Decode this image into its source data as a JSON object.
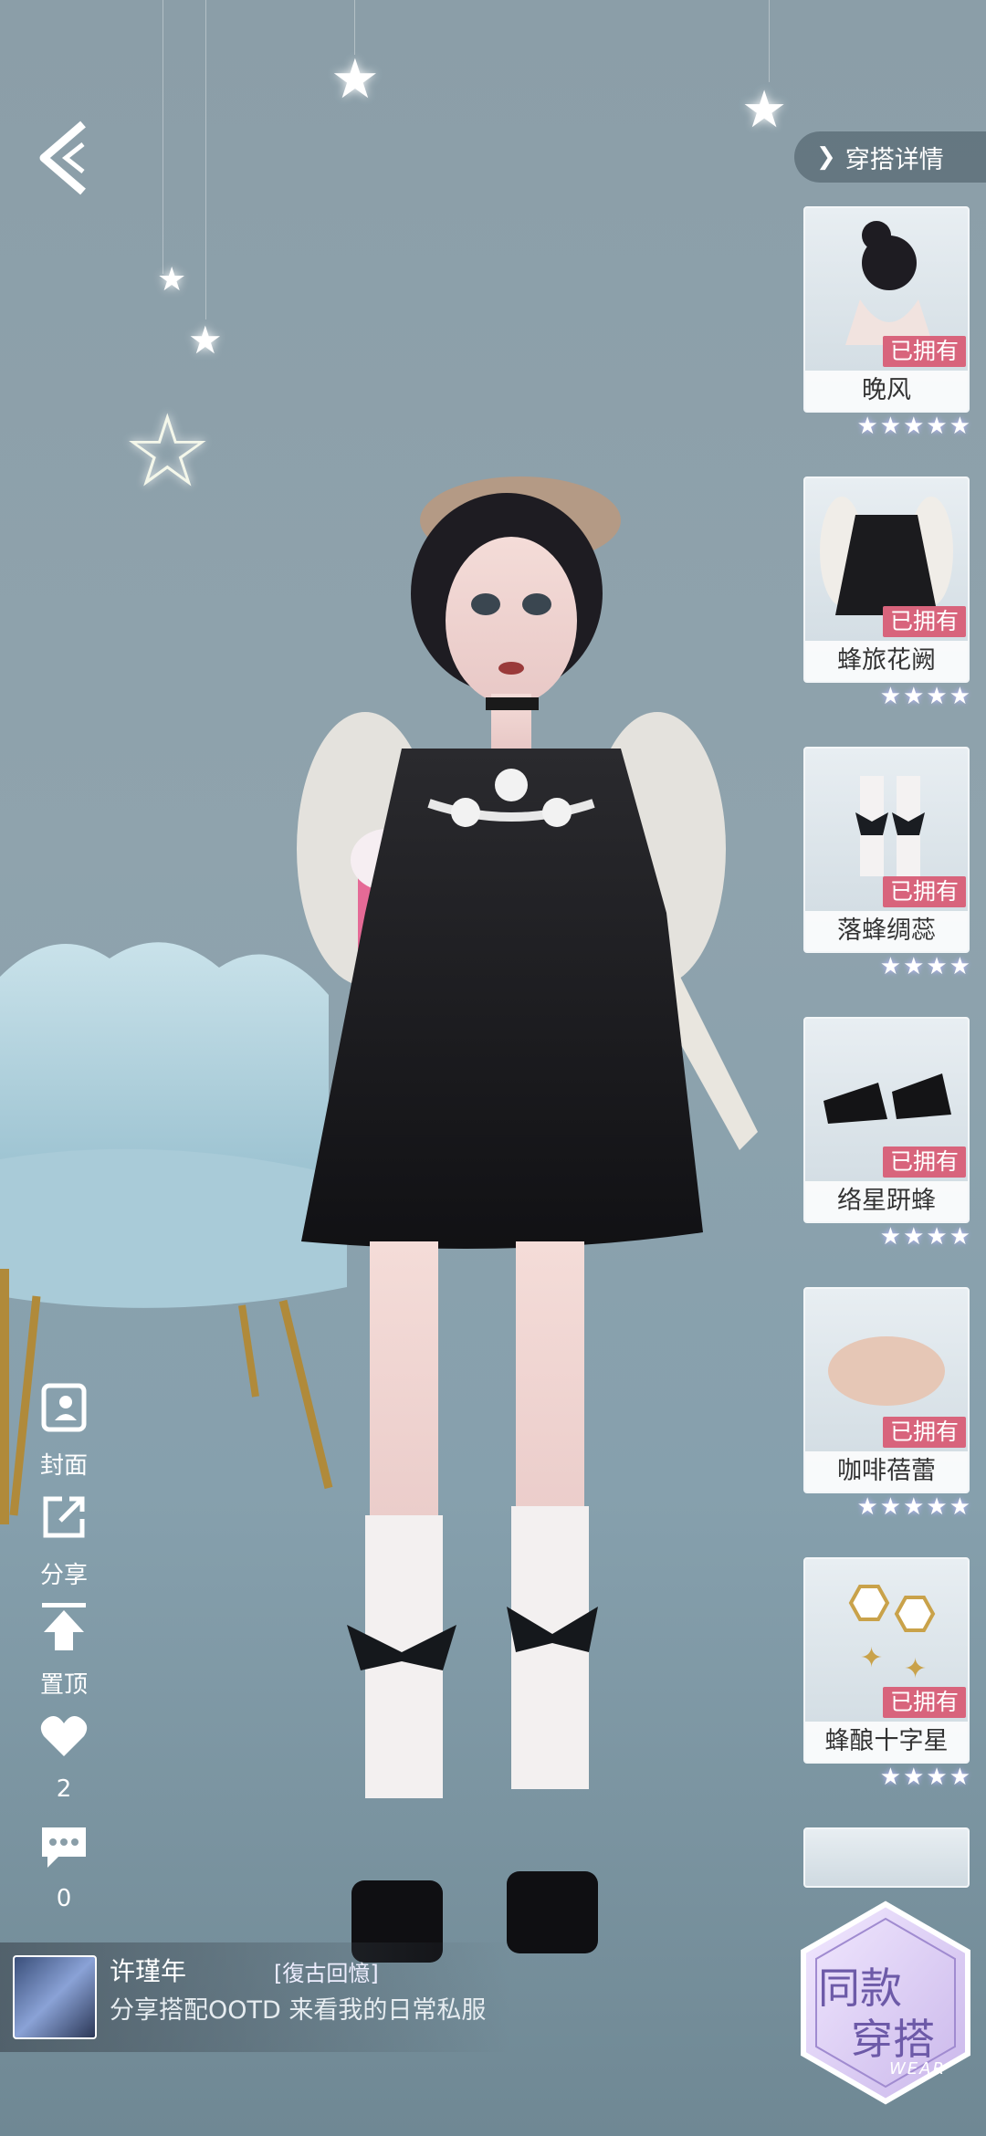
{
  "header": {
    "detail_label": "穿搭详情"
  },
  "items": [
    {
      "name": "晚风",
      "owned": "已拥有",
      "stars": "★★★★★"
    },
    {
      "name": "蜂旅花阙",
      "owned": "已拥有",
      "stars": "★★★★"
    },
    {
      "name": "落蜂绸蕊",
      "owned": "已拥有",
      "stars": "★★★★"
    },
    {
      "name": "络星趼蜂",
      "owned": "已拥有",
      "stars": "★★★★"
    },
    {
      "name": "咖啡蓓蕾",
      "owned": "已拥有",
      "stars": "★★★★★"
    },
    {
      "name": "蜂酿十字星",
      "owned": "已拥有",
      "stars": "★★★★"
    }
  ],
  "side_tools": {
    "cover": "封面",
    "share": "分享",
    "pin": "置顶",
    "likes": "2",
    "comments": "0"
  },
  "post": {
    "username": "许瑾年",
    "tag": "[復古回憶]",
    "description": "分享搭配OOTD 来看我的日常私服"
  },
  "same_outfit": {
    "line1": "同款",
    "line2": "穿搭",
    "sub": "WEAR"
  }
}
